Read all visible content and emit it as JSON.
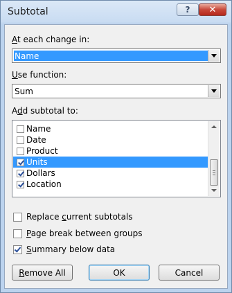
{
  "window": {
    "title": "Subtotal",
    "help_label": "?",
    "close_label": "✕"
  },
  "change_in": {
    "label": "At each change in:",
    "value": "Name"
  },
  "use_function": {
    "label": "Use function:",
    "value": "Sum"
  },
  "add_subtotal": {
    "label": "Add subtotal to:",
    "items": [
      {
        "label": "Name",
        "checked": false,
        "selected": false
      },
      {
        "label": "Date",
        "checked": false,
        "selected": false
      },
      {
        "label": "Product",
        "checked": false,
        "selected": false
      },
      {
        "label": "Units",
        "checked": true,
        "selected": true
      },
      {
        "label": "Dollars",
        "checked": true,
        "selected": false
      },
      {
        "label": "Location",
        "checked": true,
        "selected": false
      }
    ]
  },
  "options": {
    "replace": {
      "label": "Replace current subtotals",
      "checked": false
    },
    "page_break": {
      "label": "Page break between groups",
      "checked": false
    },
    "summary": {
      "label": "Summary below data",
      "checked": true
    }
  },
  "buttons": {
    "remove_all": "Remove All",
    "ok": "OK",
    "cancel": "Cancel"
  },
  "colors": {
    "selection": "#3399ff",
    "close_button": "#c8473a"
  }
}
